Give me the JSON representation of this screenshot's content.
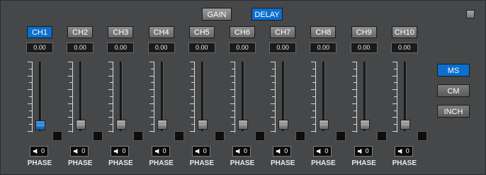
{
  "modes": [
    {
      "label": "GAIN",
      "active": false
    },
    {
      "label": "DELAY",
      "active": true
    }
  ],
  "channels": [
    {
      "label": "CH1",
      "value": "0.00",
      "phase": "0",
      "phase_label": "PHASE",
      "active": true
    },
    {
      "label": "CH2",
      "value": "0.00",
      "phase": "0",
      "phase_label": "PHASE",
      "active": false
    },
    {
      "label": "CH3",
      "value": "0.00",
      "phase": "0",
      "phase_label": "PHASE",
      "active": false
    },
    {
      "label": "CH4",
      "value": "0.00",
      "phase": "0",
      "phase_label": "PHASE",
      "active": false
    },
    {
      "label": "CH5",
      "value": "0.00",
      "phase": "0",
      "phase_label": "PHASE",
      "active": false
    },
    {
      "label": "CH6",
      "value": "0.00",
      "phase": "0",
      "phase_label": "PHASE",
      "active": false
    },
    {
      "label": "CH7",
      "value": "0.00",
      "phase": "0",
      "phase_label": "PHASE",
      "active": false
    },
    {
      "label": "CH8",
      "value": "0.00",
      "phase": "0",
      "phase_label": "PHASE",
      "active": false
    },
    {
      "label": "CH9",
      "value": "0.00",
      "phase": "0",
      "phase_label": "PHASE",
      "active": false
    },
    {
      "label": "CH10",
      "value": "0.00",
      "phase": "0",
      "phase_label": "PHASE",
      "active": false
    }
  ],
  "units": [
    {
      "label": "MS",
      "active": true
    },
    {
      "label": "CM",
      "active": false
    },
    {
      "label": "INCH",
      "active": false
    }
  ],
  "colors": {
    "accent": "#0a6fcf",
    "background": "#454749"
  }
}
